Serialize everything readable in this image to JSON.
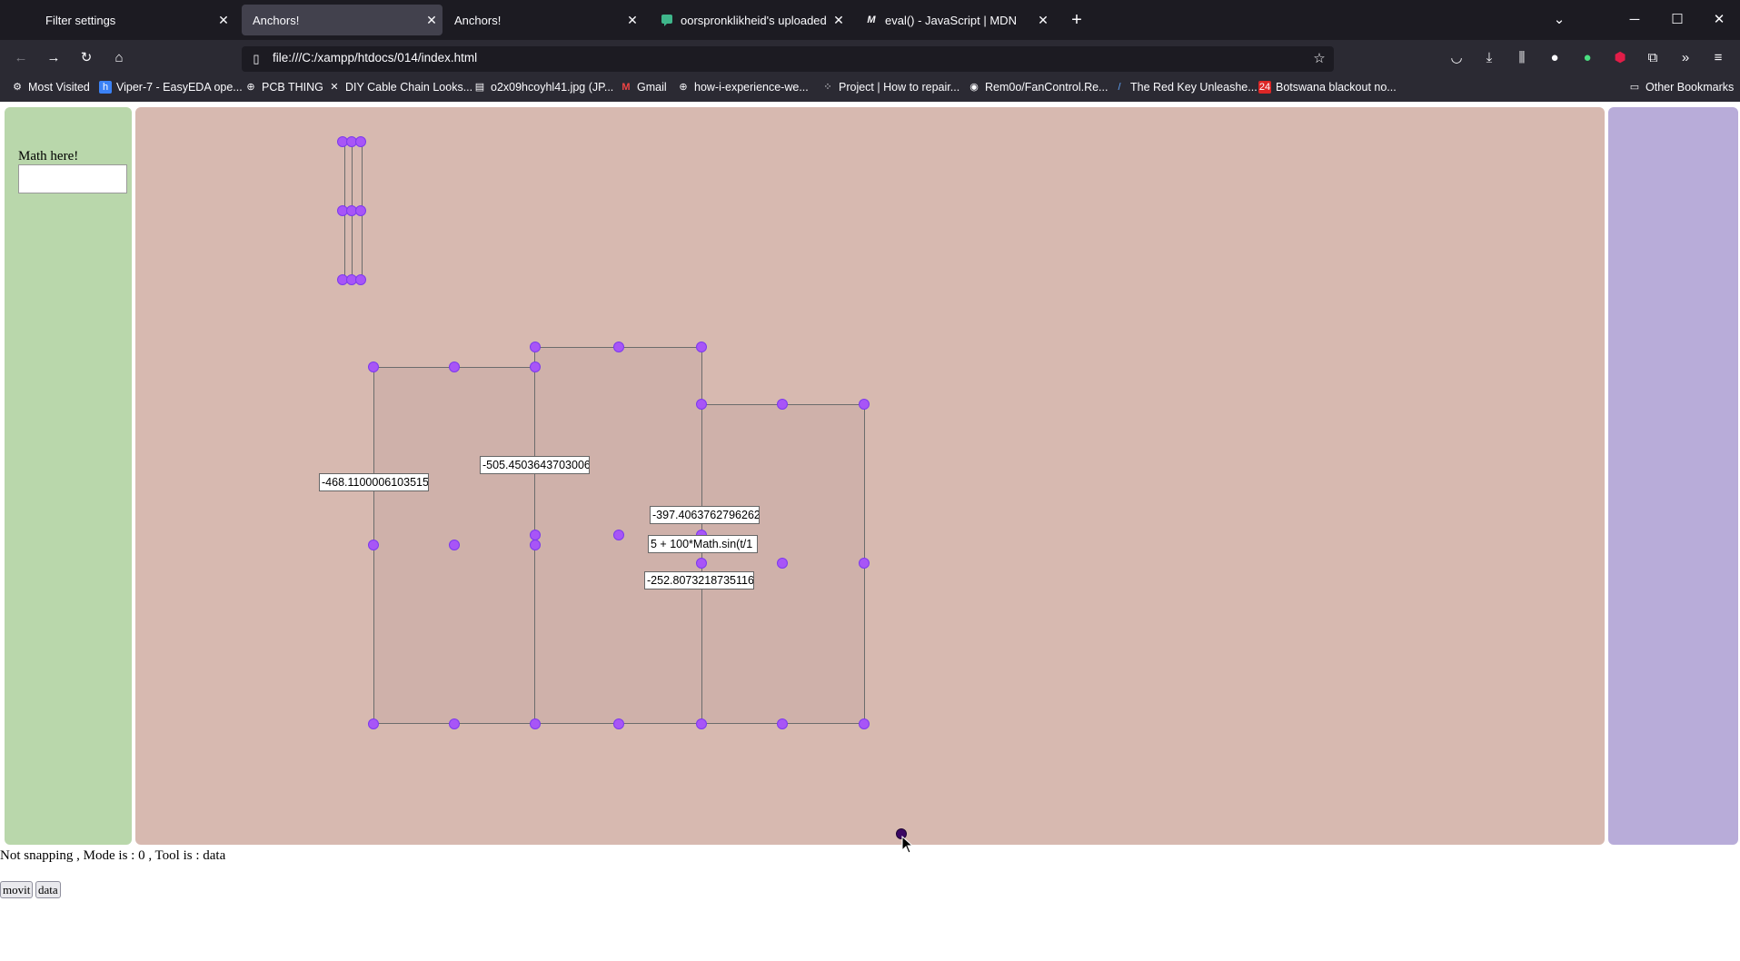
{
  "browser": {
    "tabs": [
      {
        "label": "Filter settings",
        "active": false
      },
      {
        "label": "Anchors!",
        "active": true
      },
      {
        "label": "Anchors!",
        "active": false
      },
      {
        "label": "oorspronklikheid's uploaded in",
        "active": false
      },
      {
        "label": "eval() - JavaScript | MDN",
        "active": false
      }
    ],
    "url": "file:///C:/xampp/htdocs/014/index.html",
    "bookmarks": [
      "Most Visited",
      "Viper-7 - EasyEDA ope...",
      "PCB THING",
      "DIY Cable Chain Looks...",
      "o2x09hcoyhl41.jpg (JP...",
      "Gmail",
      "how-i-experience-we...",
      "Project | How to repair...",
      "Rem0o/FanControl.Re...",
      "The Red Key Unleashe...",
      "Botswana blackout no..."
    ],
    "other_bookmarks": "Other Bookmarks"
  },
  "sidebar": {
    "math_label": "Math here!",
    "math_input_value": ""
  },
  "canvas": {
    "value_boxes": [
      "-468.1100006103515",
      "-505.4503643703006",
      "-397.4063762796262",
      "5 + 100*Math.sin(t/1",
      "-252.8073218735116"
    ]
  },
  "status": "Not snapping , Mode is : 0 , Tool is : data",
  "buttons": {
    "movit": "movit",
    "data": "data"
  },
  "colors": {
    "left_panel": "#b9d7ab",
    "canvas": "#d7b9b0",
    "right_panel": "#b8acd9",
    "anchor": "#a855f7"
  }
}
